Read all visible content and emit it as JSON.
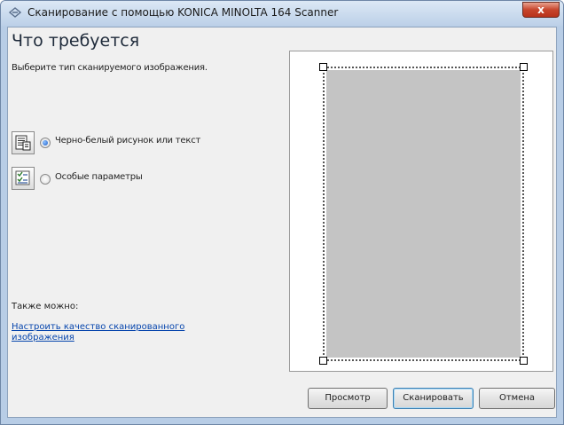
{
  "window": {
    "title": "Сканирование с помощью KONICA MINOLTA 164 Scanner",
    "close_glyph": "x"
  },
  "main": {
    "heading": "Что требуется",
    "subtitle": "Выберите тип сканируемого изображения.",
    "options": [
      {
        "label": "Черно-белый рисунок или текст",
        "icon": "text-document-icon",
        "selected": true
      },
      {
        "label": "Особые параметры",
        "icon": "custom-settings-icon",
        "selected": false
      }
    ],
    "also_label": "Также можно:",
    "link_text": "Настроить качество сканированного изображения"
  },
  "buttons": {
    "preview": "Просмотр",
    "scan": "Сканировать",
    "cancel": "Отмена"
  },
  "colors": {
    "accent": "#1d5fc9",
    "link": "#0645ad",
    "scan_area": "#c4c4c4"
  }
}
